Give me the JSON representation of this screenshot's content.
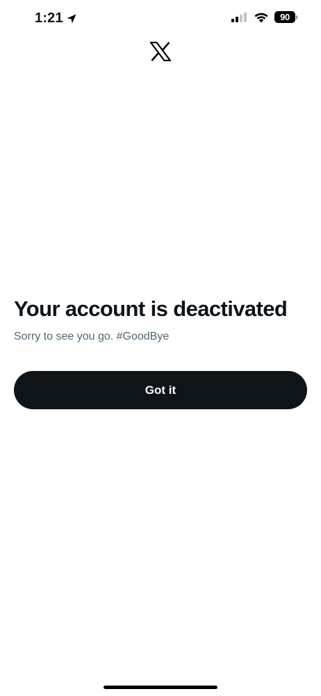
{
  "status_bar": {
    "time": "1:21",
    "battery_level": "90",
    "location_icon": "location-arrow-icon",
    "signal_icon": "cellular-signal-icon",
    "wifi_icon": "wifi-icon"
  },
  "header": {
    "logo_icon": "x-logo-icon"
  },
  "main": {
    "title": "Your account is deactivated",
    "subtitle": "Sorry to see you go. #GoodBye",
    "button_label": "Got it"
  },
  "colors": {
    "button_background": "#0f1419",
    "button_text": "#ffffff",
    "subtitle_text": "#536471",
    "title_text": "#0f1419"
  }
}
